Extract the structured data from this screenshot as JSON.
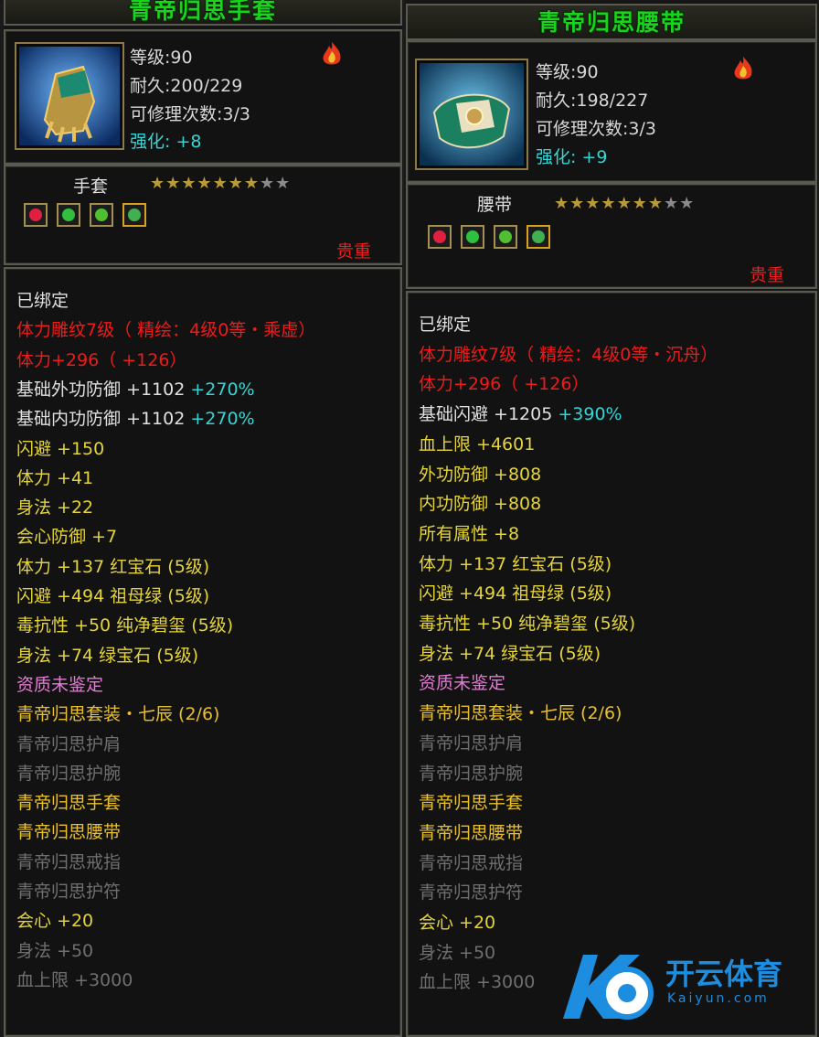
{
  "colors": {
    "title_green": "#19d31c",
    "enhance_cyan": "#33d5d5",
    "precious_red": "#e82020",
    "bound_white": "#e0e0e0",
    "set_gold": "#e8c030",
    "quality_pink": "#e878d8",
    "inactive_gray": "#6f6f6f"
  },
  "left": {
    "title": "青帝归思手套",
    "level": "等级:90",
    "durability": "耐久:200/229",
    "repair": "可修理次数:3/3",
    "enhance_label": "强化:",
    "enhance_value": "+8",
    "slot": "手套",
    "stars_filled": 7,
    "stars_total": 9,
    "precious": "贵重",
    "icon": "gauntlet-icon",
    "lines": [
      {
        "text": "已绑定",
        "color": "white"
      },
      {
        "text": "体力雕纹7级（ 精绘：4级0等・乘虚）",
        "color": "red"
      },
      {
        "text": "体力+296（ +126）",
        "color": "red"
      },
      {
        "text": "基础外功防御 +1102 ",
        "extra": "+270%",
        "color": "white"
      },
      {
        "text": "基础内功防御 +1102 ",
        "extra": "+270%",
        "color": "white"
      },
      {
        "text": "闪避 +150",
        "color": "yellow"
      },
      {
        "text": "体力 +41",
        "color": "yellow"
      },
      {
        "text": "身法 +22",
        "color": "yellow"
      },
      {
        "text": "会心防御 +7",
        "color": "yellow"
      },
      {
        "text": "体力 +137 红宝石 (5级)",
        "color": "yellow"
      },
      {
        "text": "闪避 +494 祖母绿 (5级)",
        "color": "yellow"
      },
      {
        "text": "毒抗性 +50 纯净碧玺 (5级)",
        "color": "yellow"
      },
      {
        "text": "身法 +74 绿宝石 (5级)",
        "color": "yellow"
      },
      {
        "text": "资质未鉴定",
        "color": "pink"
      },
      {
        "text": "青帝归思套装・七辰  (2/6)",
        "color": "gold"
      },
      {
        "text": "青帝归思护肩",
        "color": "gray"
      },
      {
        "text": "青帝归思护腕",
        "color": "gray"
      },
      {
        "text": "青帝归思手套",
        "color": "gold"
      },
      {
        "text": "青帝归思腰带",
        "color": "gold"
      },
      {
        "text": "青帝归思戒指",
        "color": "gray"
      },
      {
        "text": "青帝归思护符",
        "color": "gray"
      },
      {
        "text": "会心 +20",
        "color": "yellow"
      },
      {
        "text": "身法 +50",
        "color": "gray"
      },
      {
        "text": "血上限 +3000",
        "color": "gray"
      }
    ]
  },
  "right": {
    "title": "青帝归思腰带",
    "level": "等级:90",
    "durability": "耐久:198/227",
    "repair": "可修理次数:3/3",
    "enhance_label": "强化:",
    "enhance_value": "+9",
    "slot": "腰带",
    "stars_filled": 7,
    "stars_total": 9,
    "precious": "贵重",
    "icon": "belt-icon",
    "lines": [
      {
        "text": "已绑定",
        "color": "white"
      },
      {
        "text": "体力雕纹7级（ 精绘：4级0等・沉舟）",
        "color": "red"
      },
      {
        "text": "体力+296（ +126）",
        "color": "red"
      },
      {
        "text": "基础闪避 +1205 ",
        "extra": "+390%",
        "color": "white"
      },
      {
        "text": "血上限 +4601",
        "color": "yellow"
      },
      {
        "text": "外功防御 +808",
        "color": "yellow"
      },
      {
        "text": "内功防御 +808",
        "color": "yellow"
      },
      {
        "text": "所有属性 +8",
        "color": "yellow"
      },
      {
        "text": "体力 +137 红宝石 (5级)",
        "color": "yellow"
      },
      {
        "text": "闪避 +494 祖母绿 (5级)",
        "color": "yellow"
      },
      {
        "text": "毒抗性 +50 纯净碧玺 (5级)",
        "color": "yellow"
      },
      {
        "text": "身法 +74 绿宝石 (5级)",
        "color": "yellow"
      },
      {
        "text": "资质未鉴定",
        "color": "pink"
      },
      {
        "text": "青帝归思套装・七辰  (2/6)",
        "color": "gold"
      },
      {
        "text": "青帝归思护肩",
        "color": "gray"
      },
      {
        "text": "青帝归思护腕",
        "color": "gray"
      },
      {
        "text": "青帝归思手套",
        "color": "gold"
      },
      {
        "text": "青帝归思腰带",
        "color": "gold"
      },
      {
        "text": "青帝归思戒指",
        "color": "gray"
      },
      {
        "text": "青帝归思护符",
        "color": "gray"
      },
      {
        "text": "会心 +20",
        "color": "yellow"
      },
      {
        "text": "身法 +50",
        "color": "gray"
      },
      {
        "text": "血上限 +3000",
        "color": "gray"
      }
    ]
  },
  "gems": [
    {
      "name": "ruby-gem-icon",
      "color": "#e02040"
    },
    {
      "name": "emerald-gem-icon",
      "color": "#30c040"
    },
    {
      "name": "green-gem-icon",
      "color": "#50c030"
    },
    {
      "name": "tourmaline-gem-icon",
      "color": "#40b050"
    }
  ],
  "watermark": {
    "brand": "开云体育",
    "sub": "Kaiyun.com"
  }
}
